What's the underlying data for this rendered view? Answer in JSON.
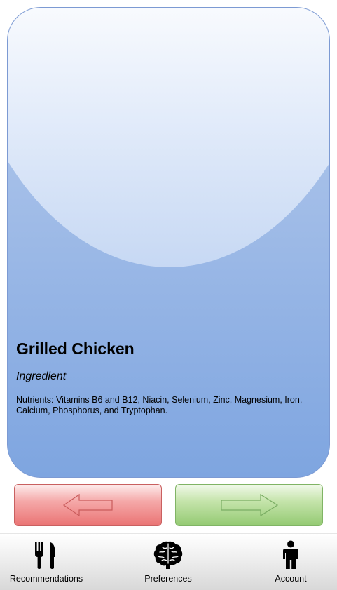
{
  "card": {
    "title": "Grilled Chicken",
    "type": "Ingredient",
    "nutrients": "Nutrients: Vitamins B6 and B12, Niacin, Selenium, Zinc, Magnesium, Iron, Calcium, Phosphorus, and Tryptophan.",
    "colors": {
      "gradient_top": "#b7cdee",
      "gradient_bottom": "#7ea5e0",
      "border": "#7c9ad3"
    }
  },
  "actions": {
    "dislike": {
      "icon": "arrow-left-icon",
      "color": "#ea7474"
    },
    "like": {
      "icon": "arrow-right-icon",
      "color": "#94ca73"
    }
  },
  "tabbar": {
    "tabs": [
      {
        "label": "Recommendations",
        "icon": "fork-knife-icon"
      },
      {
        "label": "Preferences",
        "icon": "brain-icon"
      },
      {
        "label": "Account",
        "icon": "person-icon"
      }
    ]
  }
}
